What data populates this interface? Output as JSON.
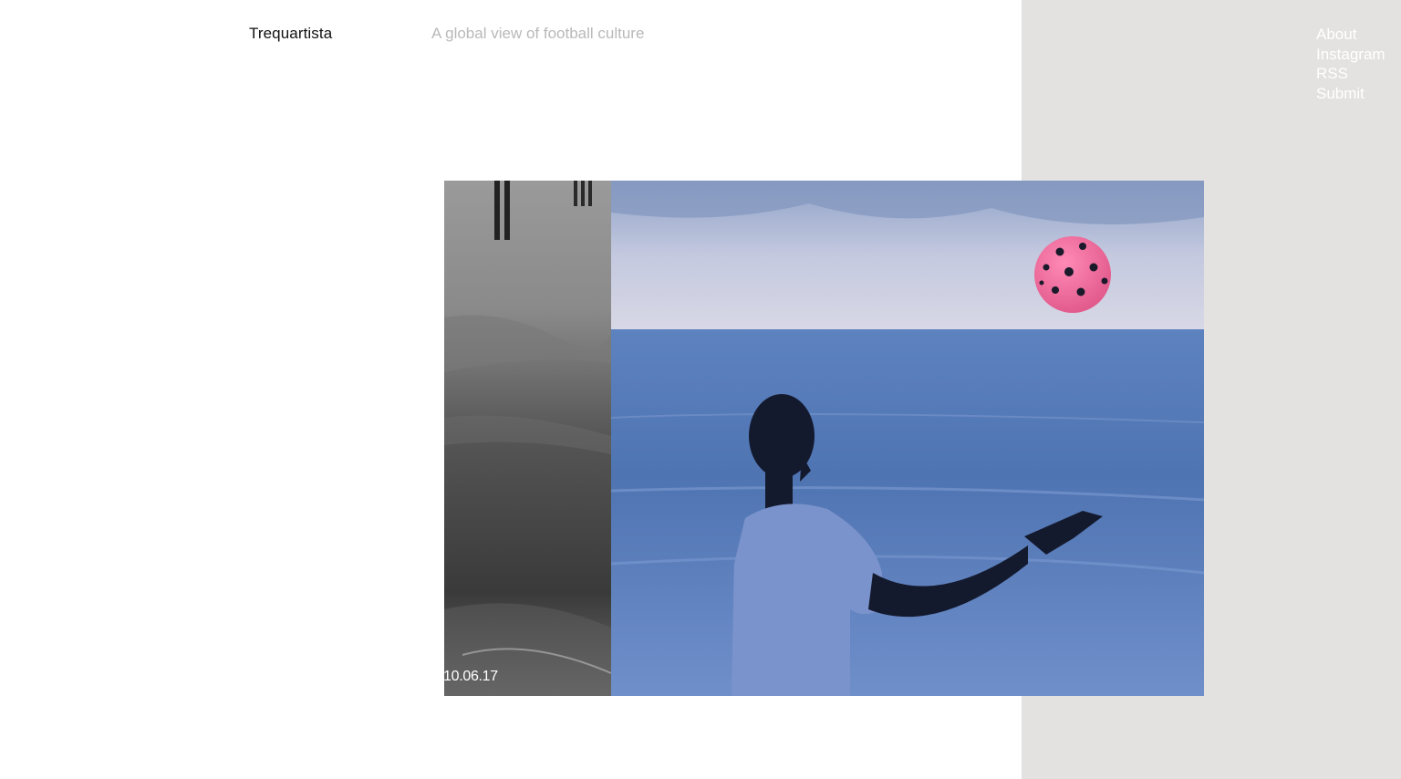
{
  "header": {
    "site_title": "Trequartista",
    "tagline": "A global view of football culture"
  },
  "nav": {
    "items": [
      {
        "label": "About"
      },
      {
        "label": "Instagram"
      },
      {
        "label": "RSS"
      },
      {
        "label": "Submit"
      }
    ]
  },
  "feature": {
    "date": "10.06.17"
  },
  "colors": {
    "panel": "#e3e2e0",
    "tagline": "#b9b9b9",
    "ball": "#f06a9b",
    "sea": "#4a72b0"
  }
}
